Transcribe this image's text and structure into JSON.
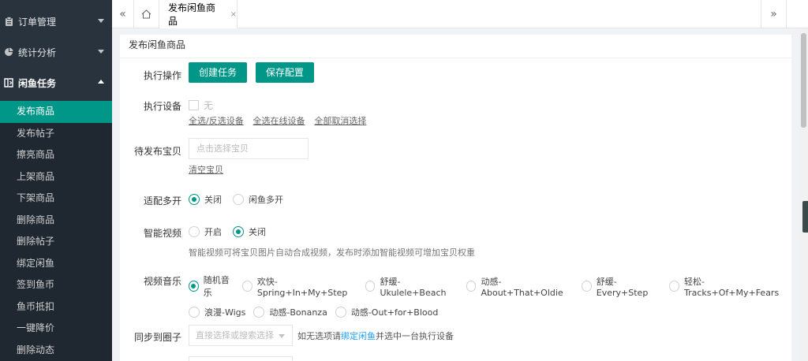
{
  "sidebar": {
    "groups": [
      {
        "label": "订单管理",
        "icon": "clipboard-icon",
        "open": false
      },
      {
        "label": "统计分析",
        "icon": "pie-chart-icon",
        "open": false
      },
      {
        "label": "闲鱼任务",
        "icon": "book-icon",
        "open": true
      }
    ],
    "items": [
      "发布商品",
      "发布帖子",
      "擦亮商品",
      "上架商品",
      "下架商品",
      "删除商品",
      "删除帖子",
      "绑定闲鱼",
      "签到鱼币",
      "鱼币抵扣",
      "一键降价",
      "删除动态"
    ],
    "active_index": 0
  },
  "tabs": {
    "active_label": "发布闲鱼商品",
    "close_glyph": "×"
  },
  "panel": {
    "title": "发布闲鱼商品",
    "exec": {
      "label": "执行操作",
      "create_btn": "创建任务",
      "save_btn": "保存配置"
    },
    "device": {
      "label": "执行设备",
      "none": "无",
      "links": [
        "全选/反选设备",
        "全选在线设备",
        "全部取消选择"
      ]
    },
    "items": {
      "label": "待发布宝贝",
      "placeholder": "点击选择宝贝",
      "clear": "清空宝贝"
    },
    "multi": {
      "label": "适配多开",
      "options": [
        "关闭",
        "闲鱼多开"
      ],
      "selected": 0
    },
    "video": {
      "label": "智能视频",
      "options": [
        "开启",
        "关闭"
      ],
      "selected": 1,
      "hint": "智能视频可将宝贝图片自动合成视频，发布时添加智能视频可增加宝贝权重"
    },
    "music": {
      "label": "视频音乐",
      "options": [
        "随机音乐",
        "欢快-Spring+In+My+Step",
        "舒缓-Ukulele+Beach",
        "动感-About+That+Oldie",
        "舒缓-Every+Step",
        "轻松-Tracks+Of+My+Fears",
        "浪漫-Wigs",
        "动感-Bonanza",
        "动感-Out+for+Blood"
      ],
      "selected": 0
    },
    "circle": {
      "label": "同步到圈子",
      "placeholder": "直接选择或搜索选择",
      "hint_pre": "如无选项请",
      "hint_link": "绑定闲鱼",
      "hint_post": "并选中一台执行设备"
    }
  },
  "colors": {
    "accent": "#009688",
    "sidebar_bg": "#28333e",
    "link": "#1e9fff"
  }
}
